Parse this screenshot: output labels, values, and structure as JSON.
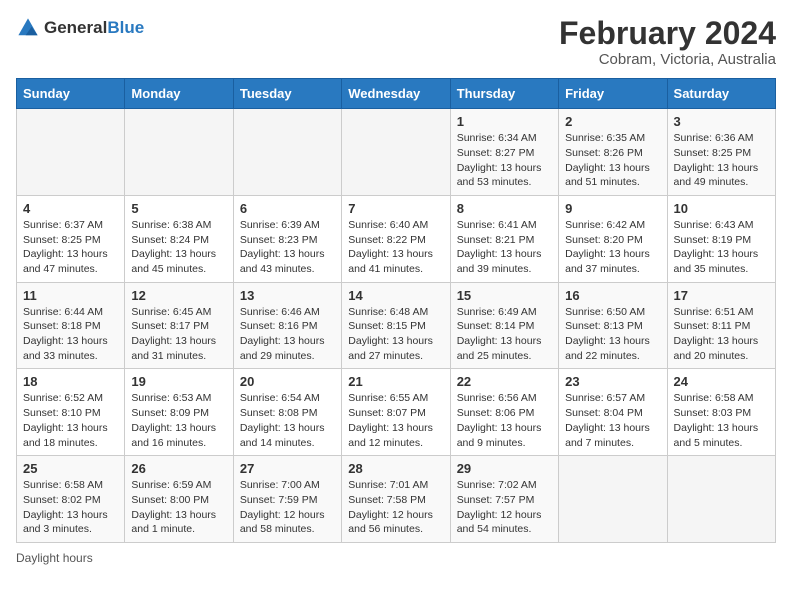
{
  "logo": {
    "text_general": "General",
    "text_blue": "Blue"
  },
  "header": {
    "title": "February 2024",
    "subtitle": "Cobram, Victoria, Australia"
  },
  "weekdays": [
    "Sunday",
    "Monday",
    "Tuesday",
    "Wednesday",
    "Thursday",
    "Friday",
    "Saturday"
  ],
  "weeks": [
    [
      {
        "day": "",
        "info": ""
      },
      {
        "day": "",
        "info": ""
      },
      {
        "day": "",
        "info": ""
      },
      {
        "day": "",
        "info": ""
      },
      {
        "day": "1",
        "info": "Sunrise: 6:34 AM\nSunset: 8:27 PM\nDaylight: 13 hours and 53 minutes."
      },
      {
        "day": "2",
        "info": "Sunrise: 6:35 AM\nSunset: 8:26 PM\nDaylight: 13 hours and 51 minutes."
      },
      {
        "day": "3",
        "info": "Sunrise: 6:36 AM\nSunset: 8:25 PM\nDaylight: 13 hours and 49 minutes."
      }
    ],
    [
      {
        "day": "4",
        "info": "Sunrise: 6:37 AM\nSunset: 8:25 PM\nDaylight: 13 hours and 47 minutes."
      },
      {
        "day": "5",
        "info": "Sunrise: 6:38 AM\nSunset: 8:24 PM\nDaylight: 13 hours and 45 minutes."
      },
      {
        "day": "6",
        "info": "Sunrise: 6:39 AM\nSunset: 8:23 PM\nDaylight: 13 hours and 43 minutes."
      },
      {
        "day": "7",
        "info": "Sunrise: 6:40 AM\nSunset: 8:22 PM\nDaylight: 13 hours and 41 minutes."
      },
      {
        "day": "8",
        "info": "Sunrise: 6:41 AM\nSunset: 8:21 PM\nDaylight: 13 hours and 39 minutes."
      },
      {
        "day": "9",
        "info": "Sunrise: 6:42 AM\nSunset: 8:20 PM\nDaylight: 13 hours and 37 minutes."
      },
      {
        "day": "10",
        "info": "Sunrise: 6:43 AM\nSunset: 8:19 PM\nDaylight: 13 hours and 35 minutes."
      }
    ],
    [
      {
        "day": "11",
        "info": "Sunrise: 6:44 AM\nSunset: 8:18 PM\nDaylight: 13 hours and 33 minutes."
      },
      {
        "day": "12",
        "info": "Sunrise: 6:45 AM\nSunset: 8:17 PM\nDaylight: 13 hours and 31 minutes."
      },
      {
        "day": "13",
        "info": "Sunrise: 6:46 AM\nSunset: 8:16 PM\nDaylight: 13 hours and 29 minutes."
      },
      {
        "day": "14",
        "info": "Sunrise: 6:48 AM\nSunset: 8:15 PM\nDaylight: 13 hours and 27 minutes."
      },
      {
        "day": "15",
        "info": "Sunrise: 6:49 AM\nSunset: 8:14 PM\nDaylight: 13 hours and 25 minutes."
      },
      {
        "day": "16",
        "info": "Sunrise: 6:50 AM\nSunset: 8:13 PM\nDaylight: 13 hours and 22 minutes."
      },
      {
        "day": "17",
        "info": "Sunrise: 6:51 AM\nSunset: 8:11 PM\nDaylight: 13 hours and 20 minutes."
      }
    ],
    [
      {
        "day": "18",
        "info": "Sunrise: 6:52 AM\nSunset: 8:10 PM\nDaylight: 13 hours and 18 minutes."
      },
      {
        "day": "19",
        "info": "Sunrise: 6:53 AM\nSunset: 8:09 PM\nDaylight: 13 hours and 16 minutes."
      },
      {
        "day": "20",
        "info": "Sunrise: 6:54 AM\nSunset: 8:08 PM\nDaylight: 13 hours and 14 minutes."
      },
      {
        "day": "21",
        "info": "Sunrise: 6:55 AM\nSunset: 8:07 PM\nDaylight: 13 hours and 12 minutes."
      },
      {
        "day": "22",
        "info": "Sunrise: 6:56 AM\nSunset: 8:06 PM\nDaylight: 13 hours and 9 minutes."
      },
      {
        "day": "23",
        "info": "Sunrise: 6:57 AM\nSunset: 8:04 PM\nDaylight: 13 hours and 7 minutes."
      },
      {
        "day": "24",
        "info": "Sunrise: 6:58 AM\nSunset: 8:03 PM\nDaylight: 13 hours and 5 minutes."
      }
    ],
    [
      {
        "day": "25",
        "info": "Sunrise: 6:58 AM\nSunset: 8:02 PM\nDaylight: 13 hours and 3 minutes."
      },
      {
        "day": "26",
        "info": "Sunrise: 6:59 AM\nSunset: 8:00 PM\nDaylight: 13 hours and 1 minute."
      },
      {
        "day": "27",
        "info": "Sunrise: 7:00 AM\nSunset: 7:59 PM\nDaylight: 12 hours and 58 minutes."
      },
      {
        "day": "28",
        "info": "Sunrise: 7:01 AM\nSunset: 7:58 PM\nDaylight: 12 hours and 56 minutes."
      },
      {
        "day": "29",
        "info": "Sunrise: 7:02 AM\nSunset: 7:57 PM\nDaylight: 12 hours and 54 minutes."
      },
      {
        "day": "",
        "info": ""
      },
      {
        "day": "",
        "info": ""
      }
    ]
  ],
  "footer": {
    "label": "Daylight hours"
  }
}
